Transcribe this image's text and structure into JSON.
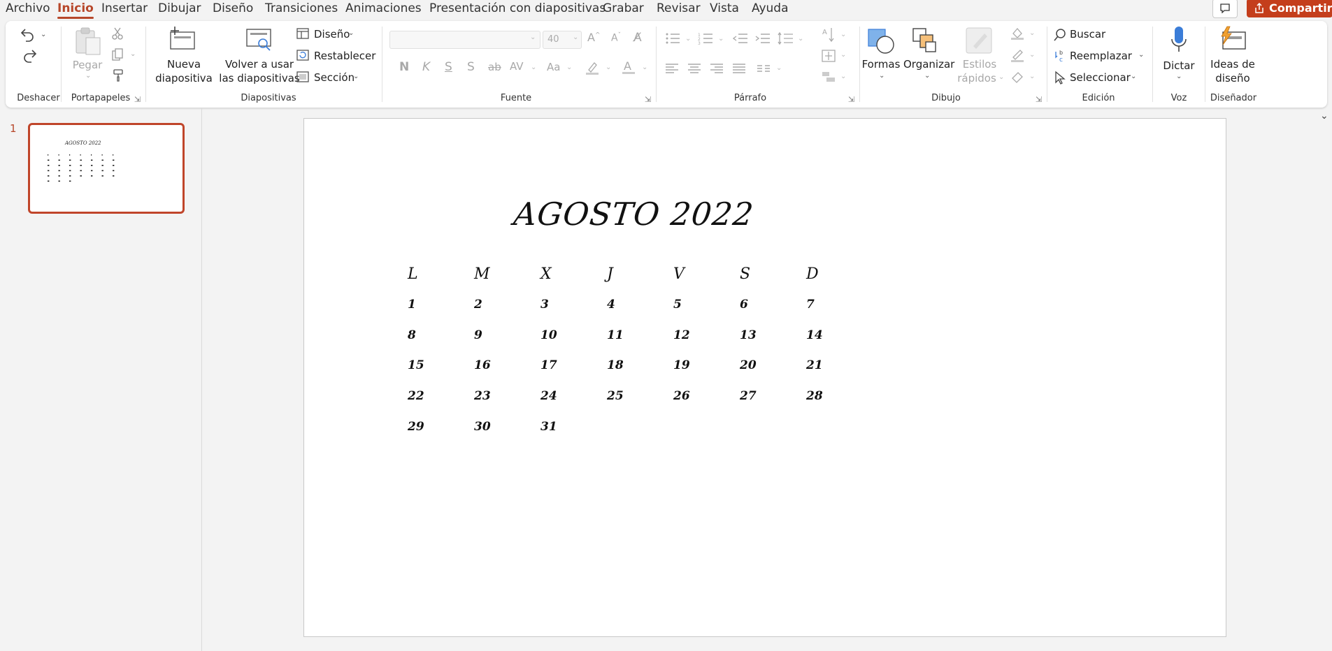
{
  "menu": {
    "tabs": [
      "Archivo",
      "Inicio",
      "Insertar",
      "Dibujar",
      "Diseño",
      "Transiciones",
      "Animaciones",
      "Presentación con diapositivas",
      "Grabar",
      "Revisar",
      "Vista",
      "Ayuda"
    ],
    "active": "Inicio",
    "share_label": "Compartir"
  },
  "ribbon": {
    "groups": {
      "undo": "Deshacer",
      "clipboard": "Portapapeles",
      "slides": "Diapositivas",
      "font": "Fuente",
      "paragraph": "Párrafo",
      "drawing": "Dibujo",
      "editing": "Edición",
      "voice": "Voz",
      "designer": "Diseñador"
    },
    "paste": "Pegar",
    "new_slide_1": "Nueva",
    "new_slide_2": "diapositiva",
    "reuse_1": "Volver a usar",
    "reuse_2": "las diapositivas",
    "layout": "Diseño",
    "reset": "Restablecer",
    "section": "Sección",
    "font_size": "40",
    "font_name": "",
    "shapes": "Formas",
    "arrange": "Organizar",
    "quick_styles_1": "Estilos",
    "quick_styles_2": "rápidos",
    "find": "Buscar",
    "replace": "Reemplazar",
    "select": "Seleccionar",
    "dictate": "Dictar",
    "ideas_1": "Ideas de",
    "ideas_2": "diseño",
    "format_bold": "N",
    "format_italic": "K",
    "format_underline": "S",
    "format_shadow": "S",
    "format_strike": "ab",
    "format_spacing": "AV",
    "format_case": "Aa"
  },
  "thumbnails": {
    "slide_number": "1"
  },
  "slide": {
    "title": "AGOSTO 2022",
    "weekdays": [
      "L",
      "M",
      "X",
      "J",
      "V",
      "S",
      "D"
    ],
    "weeks": [
      [
        "1",
        "2",
        "3",
        "4",
        "5",
        "6",
        "7"
      ],
      [
        "8",
        "9",
        "10",
        "11",
        "12",
        "13",
        "14"
      ],
      [
        "15",
        "16",
        "17",
        "18",
        "19",
        "20",
        "21"
      ],
      [
        "22",
        "23",
        "24",
        "25",
        "26",
        "27",
        "28"
      ],
      [
        "29",
        "30",
        "31",
        "",
        "",
        "",
        ""
      ]
    ]
  }
}
